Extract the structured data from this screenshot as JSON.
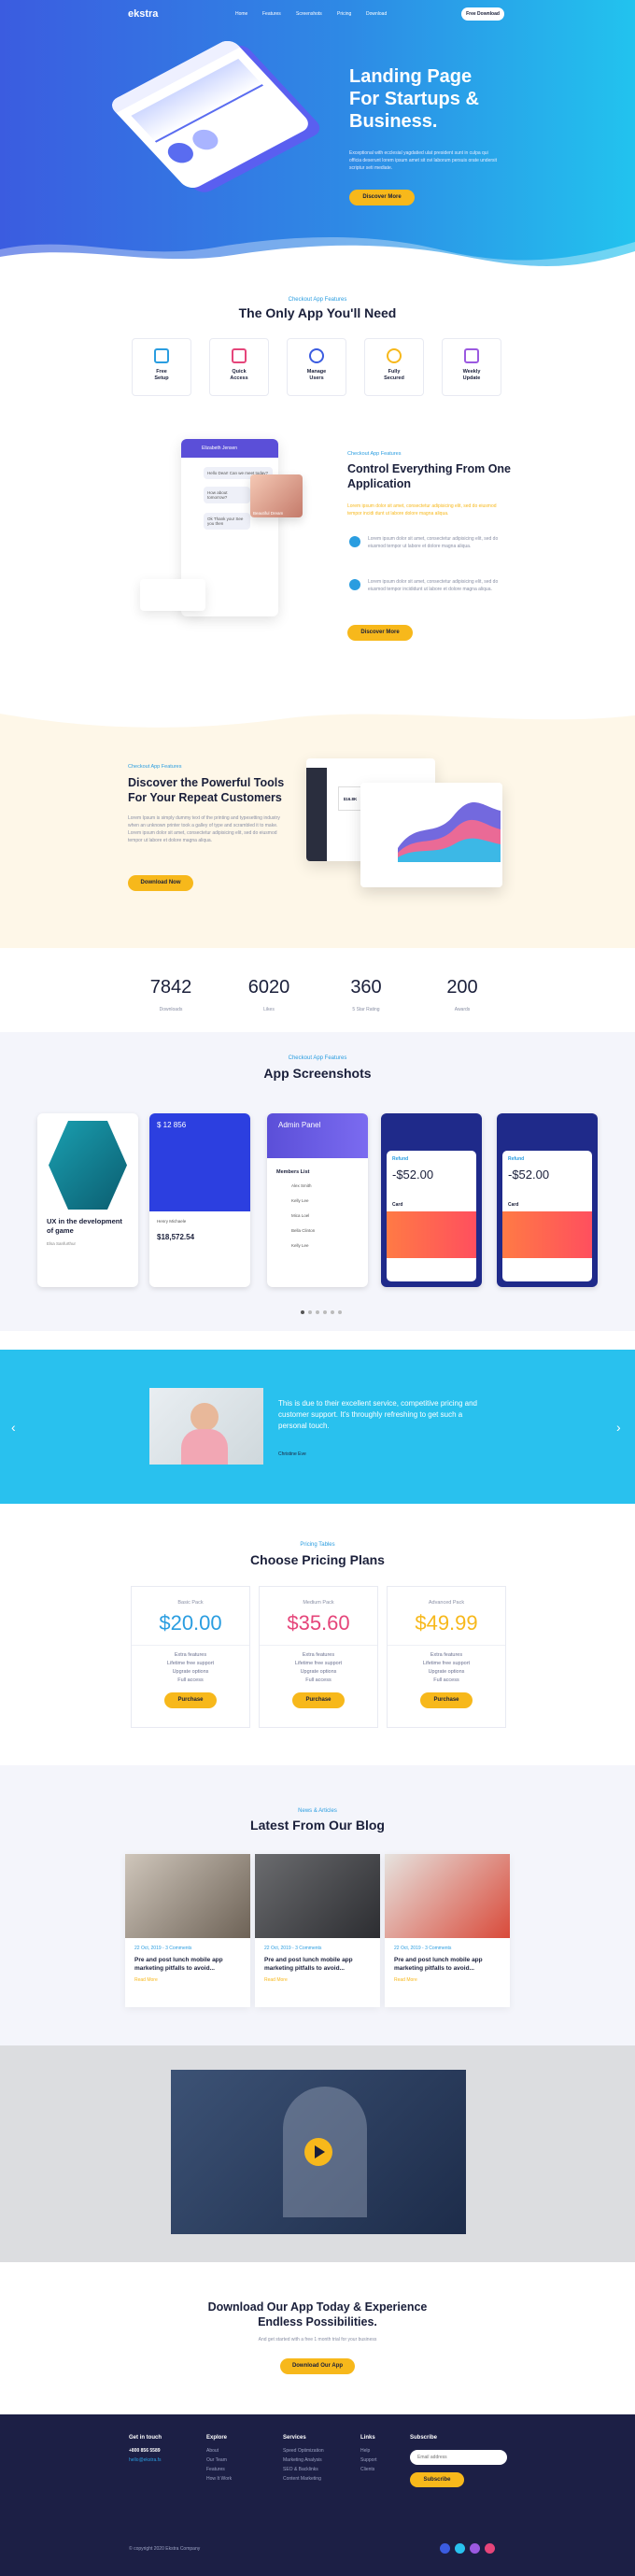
{
  "nav": {
    "logo": "ekstra",
    "links": [
      "Home",
      "Features",
      "Screenshots",
      "Pricing",
      "Download"
    ],
    "cta": "Free Download"
  },
  "hero": {
    "title_lines": [
      "Landing Page",
      "For Startups &",
      "Business."
    ],
    "text": "Exceptional with ecclesial yagdatied ulat president sunt in culpa qui officia deserunt lorem ipsum amet sit ovi laborum persuis orate undersit scriptur seti mediate.",
    "button": "Discover More"
  },
  "features": {
    "eyebrow": "Checkout App Features",
    "title": "The Only App You'll Need",
    "items": [
      {
        "label_1": "Free",
        "label_2": "Setup",
        "color": "#2a9de0"
      },
      {
        "label_1": "Quick",
        "label_2": "Access",
        "color": "#e5457a"
      },
      {
        "label_1": "Manage",
        "label_2": "Users",
        "color": "#3b5ce0"
      },
      {
        "label_1": "Fully",
        "label_2": "Secured",
        "color": "#f7b81b"
      },
      {
        "label_1": "Weekly",
        "label_2": "Update",
        "color": "#9b59e0"
      }
    ]
  },
  "control": {
    "eyebrow": "Checkout App Features",
    "title_lines": [
      "Control Everything From One",
      "Application"
    ],
    "intro": "Lorem ipsum dolor sit amet, consectetur adipisicing elit, sed do eiusmod tempor incidi dunt ut labore dolore magna aliqua.",
    "points": [
      "Lorem ipsum dolor sit amet, consectetur adipisicing elit, sed do eiusmod tempor ut labore et dolore magna aliqua.",
      "Lorem ipsum dolor sit amet, consectetur adipisicing elit, sed do eiusmod tempor incididunt ut labore et dolore magna aliqua."
    ],
    "button": "Discover More",
    "phone": {
      "name": "Elizabeth Jensen",
      "msg1": "Hello Dear! Can we meet today?",
      "msg2": "How about tomorrow?",
      "msg3": "Ok Thank you! See you then",
      "caption": "Beautiful Dream"
    }
  },
  "discover": {
    "eyebrow": "Checkout App Features",
    "title_lines": [
      "Discover the Powerful Tools",
      "For Your Repeat Customers"
    ],
    "text": "Lorem Ipsum is simply dummy text of the printing and typesetting industry when an unknown printer took a galley of type and scrambled it to make. Lorem ipsum dolor sit amet, consectetur adipisicing elit, sed do eiusmod tempor ut labore et dolore magna aliqua.",
    "button": "Download Now",
    "dash_value": "$16.8K"
  },
  "stats": [
    {
      "value": "7842",
      "label": "Downloads"
    },
    {
      "value": "6020",
      "label": "Likes"
    },
    {
      "value": "360",
      "label": "5 Star Rating"
    },
    {
      "value": "200",
      "label": "Awards"
    }
  ],
  "screenshots": {
    "eyebrow": "Checkout App Features",
    "title": "App Screenshots",
    "shot1": {
      "title": "UX in the development of game",
      "author": "Elsa Sanfurthur"
    },
    "shot2": {
      "top_value": "$ 12 856",
      "bottom_value": "$18,572.54",
      "user": "Henry Michaele"
    },
    "shot3": {
      "header": "Admin Panel",
      "list_title": "Members List",
      "names": [
        "Alex Smith",
        "Kelly Lee",
        "Mica Loel",
        "Bella Clinton",
        "Kelly Lee"
      ]
    },
    "shot4": {
      "label": "Refund",
      "value": "-$52.00",
      "card": "Card"
    },
    "shot5": {
      "label": "Refund",
      "value": "-$52.00",
      "card": "Card"
    }
  },
  "testimonial": {
    "quote": "This is due to their excellent service, competitive pricing and customer support. It's throughly refreshing to get such a personal touch.",
    "author": "Christine Eve",
    "bg": "#29c1ee"
  },
  "pricing": {
    "eyebrow": "Pricing Tables",
    "title": "Choose Pricing Plans",
    "plans": [
      {
        "name": "Basic Pack",
        "price": "$20.00",
        "color": "#2a9de0",
        "features": [
          "Extra features",
          "Lifetime free support",
          "Upgrate options",
          "Full access"
        ],
        "button": "Purchase"
      },
      {
        "name": "Medium Pack",
        "price": "$35.60",
        "color": "#e5457a",
        "features": [
          "Extra features",
          "Lifetime free support",
          "Upgrate options",
          "Full access"
        ],
        "button": "Purchase"
      },
      {
        "name": "Advanced Pack",
        "price": "$49.99",
        "color": "#f7b81b",
        "features": [
          "Extra features",
          "Lifetime free support",
          "Upgrate options",
          "Full access"
        ],
        "button": "Purchase"
      }
    ]
  },
  "blog": {
    "eyebrow": "News & Articles",
    "title": "Latest From Our Blog",
    "posts": [
      {
        "meta": "22 Oct, 2019 - 3 Comments",
        "title": "Pre and post lunch mobile app marketing pitfalls to avoid...",
        "more": "Read More"
      },
      {
        "meta": "22 Oct, 2019 - 3 Comments",
        "title": "Pre and post lunch mobile app marketing pitfalls to avoid...",
        "more": "Read More"
      },
      {
        "meta": "22 Oct, 2019 - 3 Comments",
        "title": "Pre and post lunch mobile app marketing pitfalls to avoid...",
        "more": "Read More"
      }
    ]
  },
  "cta": {
    "title_lines": [
      "Download Our App Today & Experience",
      "Endless Possibilities."
    ],
    "text": "And get started with a free 1 month trial for your business",
    "button": "Download Our App"
  },
  "footer": {
    "cols": [
      {
        "title": "Get in touch",
        "items": [
          "+800 856 5589",
          "hello@ekstra.fs"
        ]
      },
      {
        "title": "Explore",
        "items": [
          "About",
          "Our Team",
          "Features",
          "How It Work"
        ]
      },
      {
        "title": "Services",
        "items": [
          "Speed Optimization",
          "Marketing Analysis",
          "SEO & Backlinks",
          "Content Marketing"
        ]
      },
      {
        "title": "Links",
        "items": [
          "Help",
          "Support",
          "Clients"
        ]
      }
    ],
    "subscribe": {
      "title": "Subscribe",
      "placeholder": "Email address",
      "button": "Subscribe"
    },
    "copyright": "© copyright 2020 Ekstra Company"
  }
}
